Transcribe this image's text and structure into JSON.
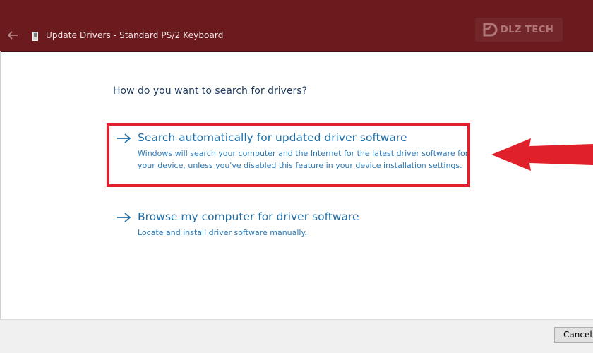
{
  "window": {
    "title": "Update Drivers - Standard PS/2 Keyboard",
    "back_icon": "back-arrow-icon",
    "app_icon": "keyboard-device-icon"
  },
  "watermark": {
    "text": "DLZ TECH"
  },
  "main": {
    "question": "How do you want to search for drivers?",
    "options": [
      {
        "title": "Search automatically for updated driver software",
        "description": "Windows will search your computer and the Internet for the latest driver software for your device, unless you've disabled this feature in your device installation settings.",
        "highlighted": true
      },
      {
        "title": "Browse my computer for driver software",
        "description": "Locate and install driver software manually.",
        "highlighted": false
      }
    ]
  },
  "annotation": {
    "box_color": "#e0202a",
    "arrow_color": "#e0202a"
  },
  "footer": {
    "cancel_label": "Cancel"
  },
  "colors": {
    "titlebar": "#6b1a1d",
    "link": "#1f6fa8",
    "heading": "#1e3a5f"
  }
}
